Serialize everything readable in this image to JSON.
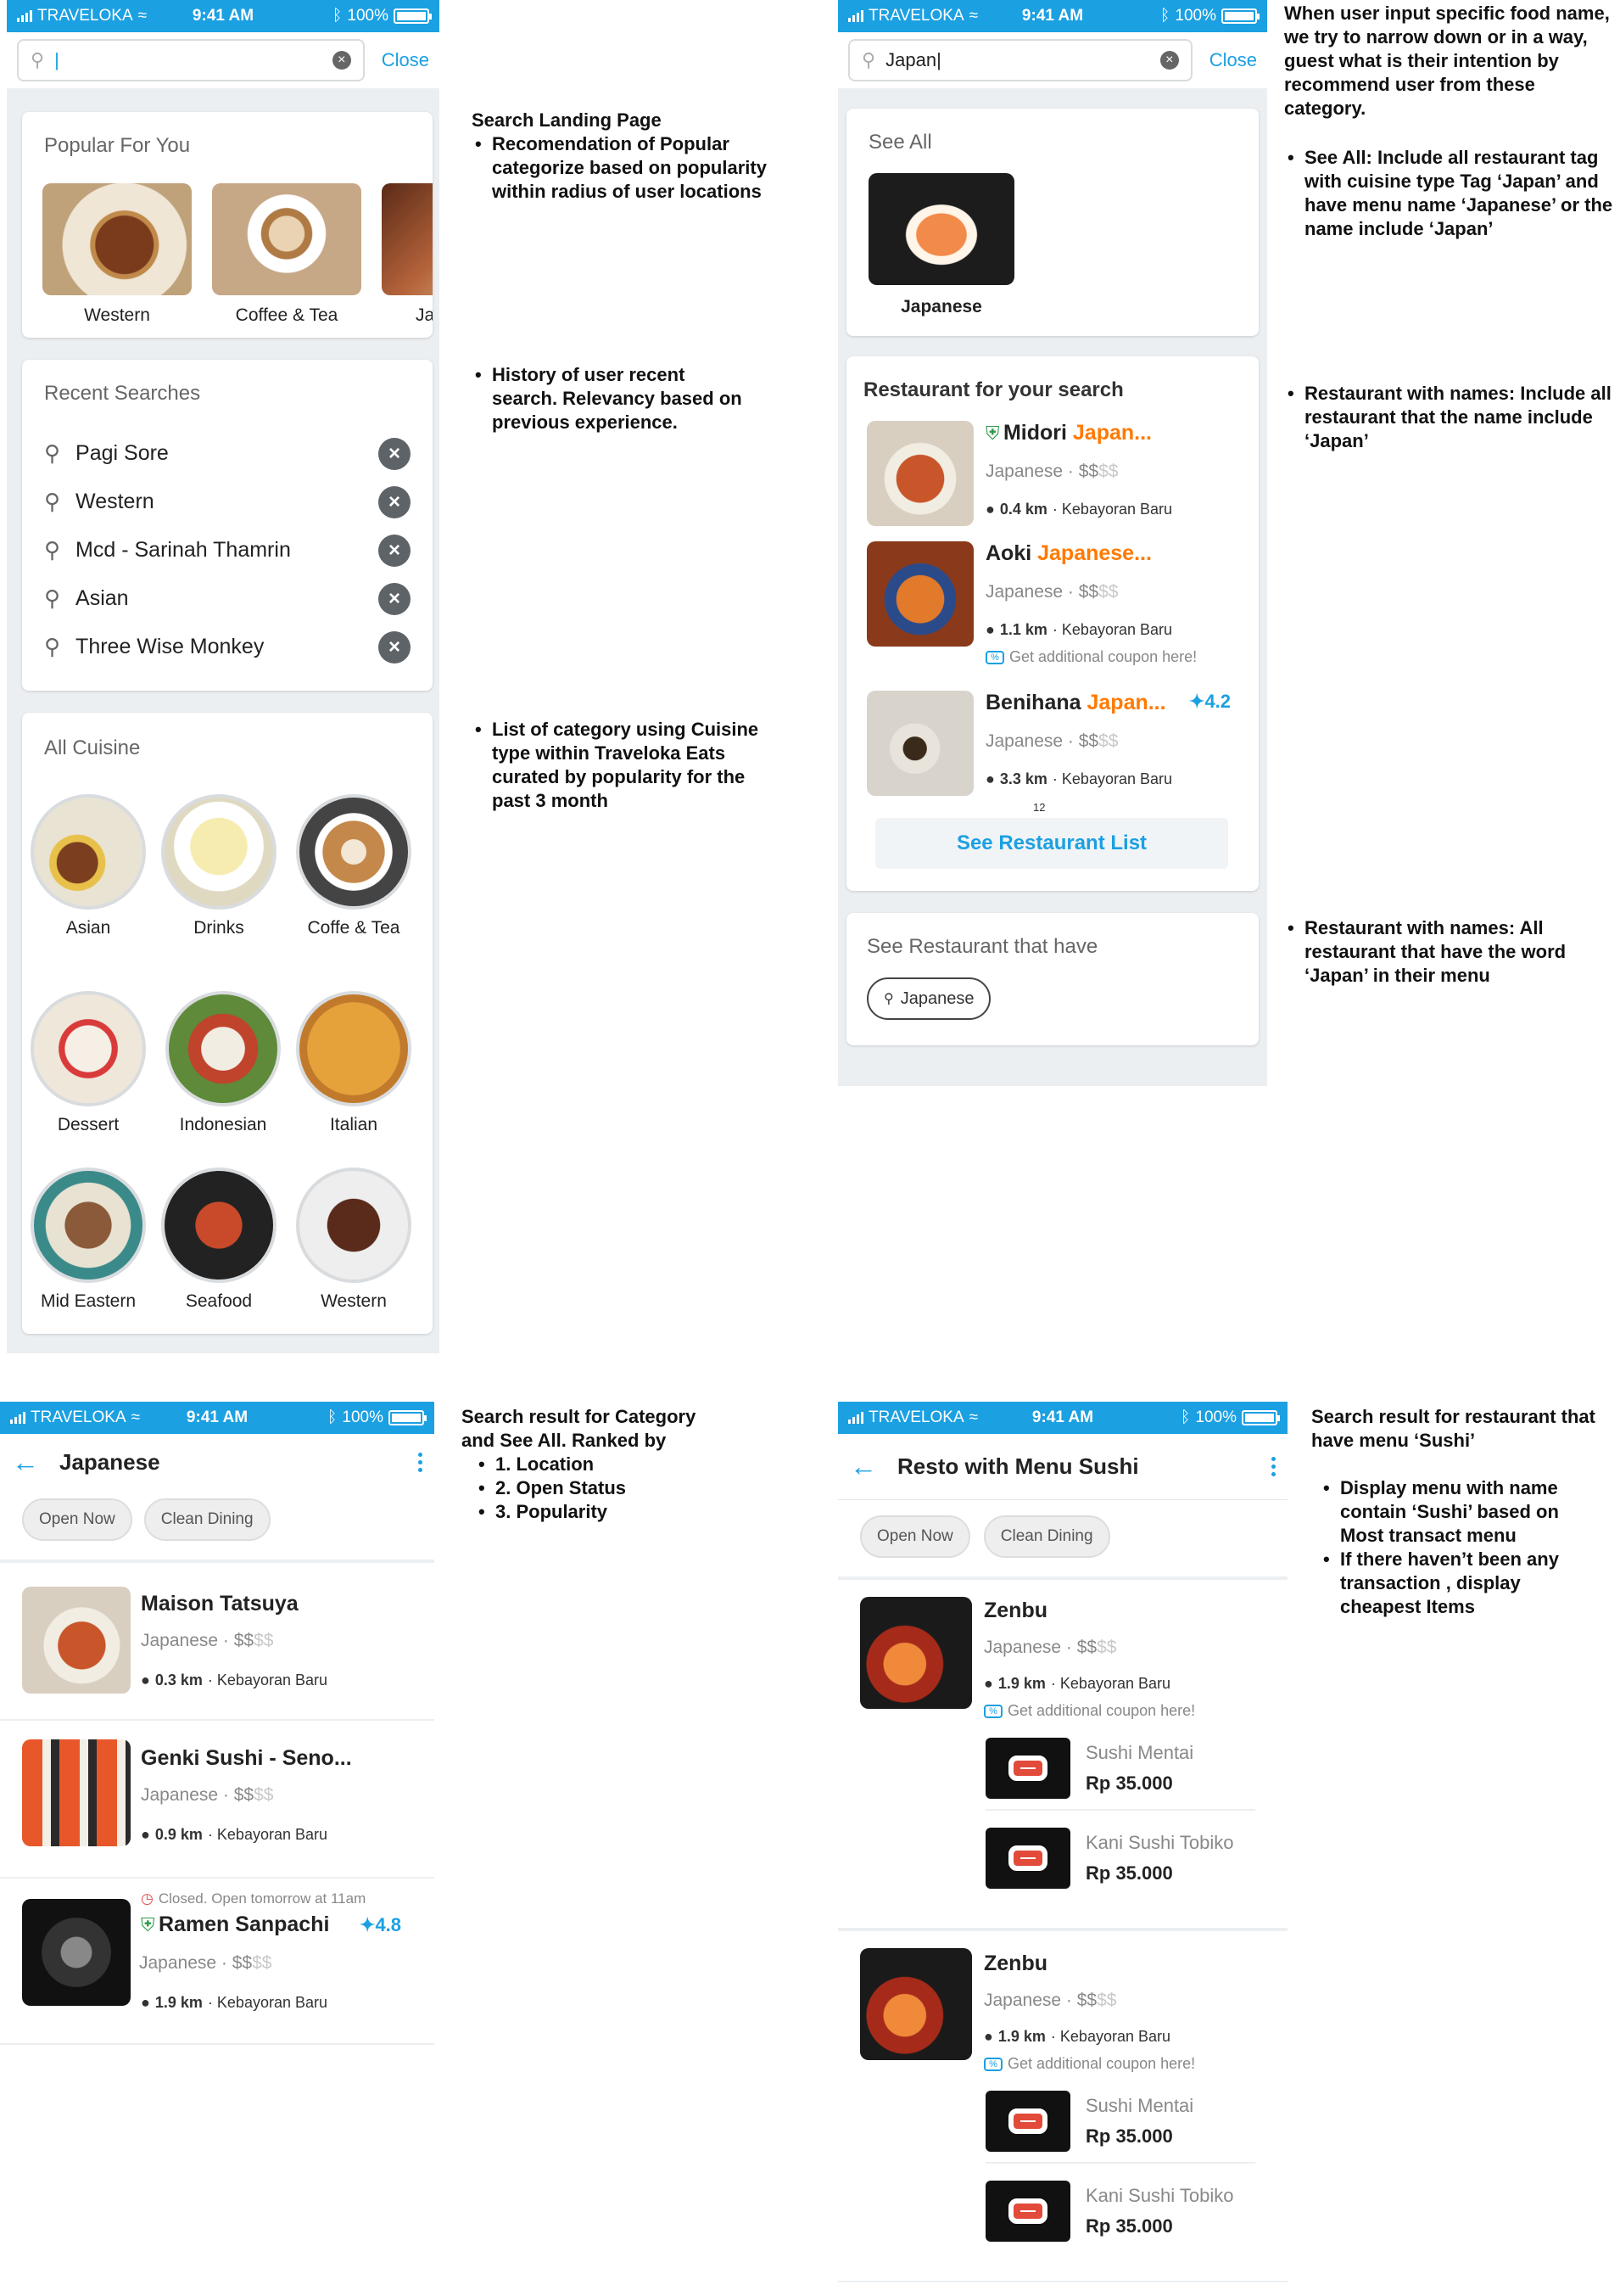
{
  "status": {
    "carrier": "TRAVELOKA",
    "time": "9:41 AM",
    "battery": "100%"
  },
  "colors": {
    "brand": "#1ba0e2",
    "highlight": "#ff7a00",
    "bg": "#eceff2"
  },
  "screen1": {
    "search": {
      "value": "|",
      "close": "Close"
    },
    "popular": {
      "title": "Popular For You",
      "items": [
        "Western",
        "Coffee & Tea",
        "Ja"
      ]
    },
    "recent": {
      "title": "Recent Searches",
      "items": [
        "Pagi Sore",
        "Western",
        "Mcd - Sarinah Thamrin",
        "Asian",
        "Three Wise Monkey"
      ]
    },
    "cuisine": {
      "title": "All Cuisine",
      "items": [
        "Asian",
        "Drinks",
        "Coffe & Tea",
        "Dessert",
        "Indonesian",
        "Italian",
        "Mid Eastern",
        "Seafood",
        "Western"
      ]
    }
  },
  "notes1": {
    "landing": {
      "head": "Search Landing Page",
      "bullet": "Recomendation of Popular categorize based on popularity within radius of user locations"
    },
    "history": {
      "bullet": "History of user recent search. Relevancy based on previous experience."
    },
    "category": {
      "bullet": "List of category using Cuisine type within Traveloka Eats curated by popularity for the past 3 month"
    }
  },
  "screen2": {
    "search": {
      "value": "Japan|",
      "close": "Close"
    },
    "seeall": {
      "title": "See All",
      "item": "Japanese"
    },
    "restaurants": {
      "title": "Restaurant for your search",
      "items": [
        {
          "name": "Midori ",
          "hl": "Japan...",
          "cat": "Japanese · $$",
          "dim": "$$",
          "dist": "0.4 km",
          "area": " · Kebayoran Baru",
          "coupon": "",
          "rating": ""
        },
        {
          "name": "Aoki ",
          "hl": "Japanese...",
          "cat": "Japanese · $$",
          "dim": "$$",
          "dist": "1.1 km",
          "area": " · Kebayoran Baru",
          "coupon": "Get additional coupon here!",
          "rating": ""
        },
        {
          "name": "Benihana ",
          "hl": "Japan...",
          "cat": "Japanese · $$",
          "dim": "$$",
          "dist": "3.3 km",
          "area": " · Kebayoran Baru",
          "coupon": "",
          "rating": "4.2"
        }
      ],
      "count": "12",
      "button": "See Restaurant List"
    },
    "menu": {
      "title": "See Restaurant that have",
      "chip": "Japanese"
    }
  },
  "notes2": {
    "intro": "When user input specific food name, we try to narrow down or in a way, guest what is their intention by recommend user from these category.",
    "seeall": "See All: Include all restaurant tag with cuisine type Tag ‘Japan’  and have menu name ‘Japanese’ or the name include ‘Japan’",
    "names": "Restaurant with names: Include all restaurant that the name include ‘Japan’",
    "menu": "Restaurant with names: All restaurant that have the word ‘Japan’ in their menu"
  },
  "screen3": {
    "title": "Japanese",
    "chips": [
      "Open Now",
      "Clean Dining"
    ],
    "items": [
      {
        "name": "Maison Tatsuya",
        "cat": "Japanese · $$",
        "dim": "$$",
        "dist": "0.3 km",
        "area": " · Kebayoran Baru",
        "closed": "",
        "rating": ""
      },
      {
        "name": "Genki Sushi - Seno...",
        "cat": "Japanese · $$",
        "dim": "$$",
        "dist": "0.9 km",
        "area": " · Kebayoran Baru",
        "closed": "",
        "rating": ""
      },
      {
        "name": "Ramen Sanpachi",
        "cat": "Japanese · $$",
        "dim": "$$",
        "dist": "1.9 km",
        "area": " · Kebayoran Baru",
        "closed": "Closed. Open tomorrow at 11am",
        "rating": "4.8"
      }
    ]
  },
  "notes3": {
    "head": "Search result for Category and See All. Ranked by",
    "items": [
      "1. Location",
      "2. Open Status",
      "3. Popularity"
    ]
  },
  "screen4": {
    "title": "Resto with Menu Sushi",
    "chips": [
      "Open Now",
      "Clean Dining"
    ],
    "items": [
      {
        "name": "Zenbu",
        "cat": "Japanese · $$",
        "dim": "$$",
        "dist": "1.9 km",
        "area": " · Kebayoran Baru",
        "coupon": "Get additional coupon here!",
        "menu": [
          {
            "name": "Sushi Mentai",
            "price": "Rp 35.000"
          },
          {
            "name": "Kani Sushi Tobiko",
            "price": "Rp 35.000"
          }
        ]
      },
      {
        "name": "Zenbu",
        "cat": "Japanese · $$",
        "dim": "$$",
        "dist": "1.9 km",
        "area": " · Kebayoran Baru",
        "coupon": "Get additional coupon here!",
        "menu": [
          {
            "name": "Sushi Mentai",
            "price": "Rp 35.000"
          },
          {
            "name": "Kani Sushi Tobiko",
            "price": "Rp 35.000"
          }
        ]
      }
    ]
  },
  "notes4": {
    "head": "Search result for restaurant that have menu ‘Sushi’",
    "items": [
      "Display menu with name contain ‘Sushi’ based on Most transact menu",
      "If there haven’t been any transaction , display cheapest Items"
    ]
  }
}
